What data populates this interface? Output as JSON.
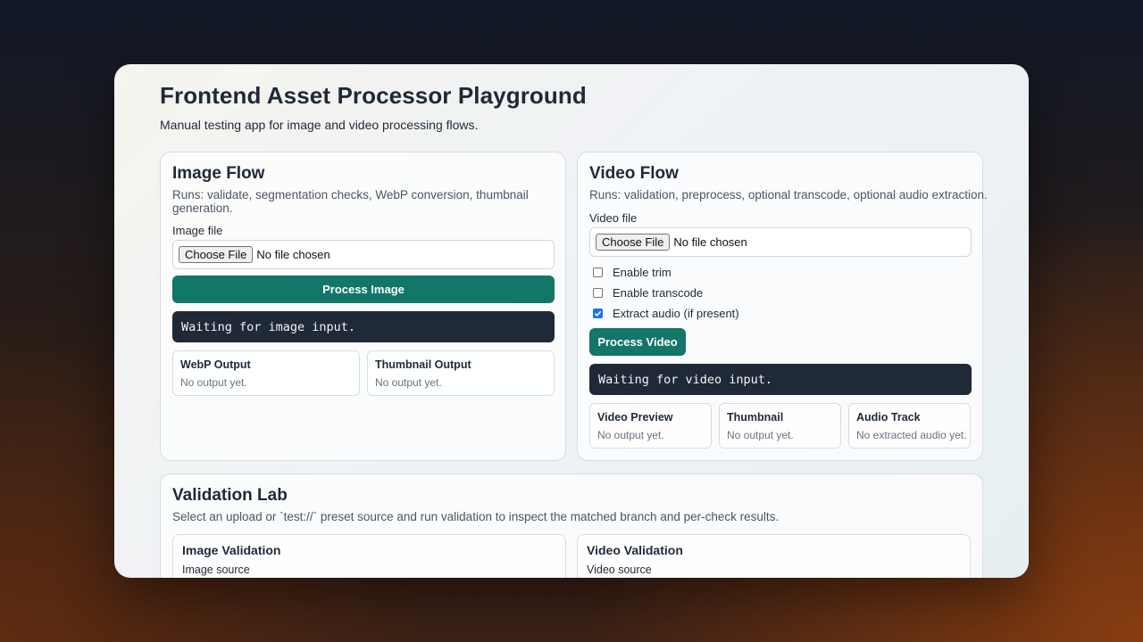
{
  "page": {
    "title": "Frontend Asset Processor Playground",
    "subtitle": "Manual testing app for image and video processing flows."
  },
  "image_flow": {
    "title": "Image Flow",
    "description": "Runs: validate, segmentation checks, WebP conversion, thumbnail generation.",
    "file_label": "Image file",
    "choose_file": "Choose File",
    "no_file": "No file chosen",
    "process_button": "Process Image",
    "status": "Waiting for image input.",
    "outputs": [
      {
        "title": "WebP Output",
        "status": "No output yet."
      },
      {
        "title": "Thumbnail Output",
        "status": "No output yet."
      }
    ]
  },
  "video_flow": {
    "title": "Video Flow",
    "description": "Runs: validation, preprocess, optional transcode, optional audio extraction.",
    "file_label": "Video file",
    "choose_file": "Choose File",
    "no_file": "No file chosen",
    "options": [
      {
        "label": "Enable trim",
        "checked": false
      },
      {
        "label": "Enable transcode",
        "checked": false
      },
      {
        "label": "Extract audio (if present)",
        "checked": true
      }
    ],
    "process_button": "Process Video",
    "status": "Waiting for video input.",
    "outputs": [
      {
        "title": "Video Preview",
        "status": "No output yet."
      },
      {
        "title": "Thumbnail",
        "status": "No output yet."
      },
      {
        "title": "Audio Track",
        "status": "No extracted audio yet."
      }
    ]
  },
  "validation_lab": {
    "title": "Validation Lab",
    "description": "Select an upload or `test://` preset source and run validation to inspect the matched branch and per-check results.",
    "image_validation": {
      "title": "Image Validation",
      "source_label": "Image source"
    },
    "video_validation": {
      "title": "Video Validation",
      "source_label": "Video source"
    }
  },
  "colors": {
    "accent": "#127668",
    "console_bg": "#1f2937",
    "checkbox_checked": "#1a73e8"
  }
}
